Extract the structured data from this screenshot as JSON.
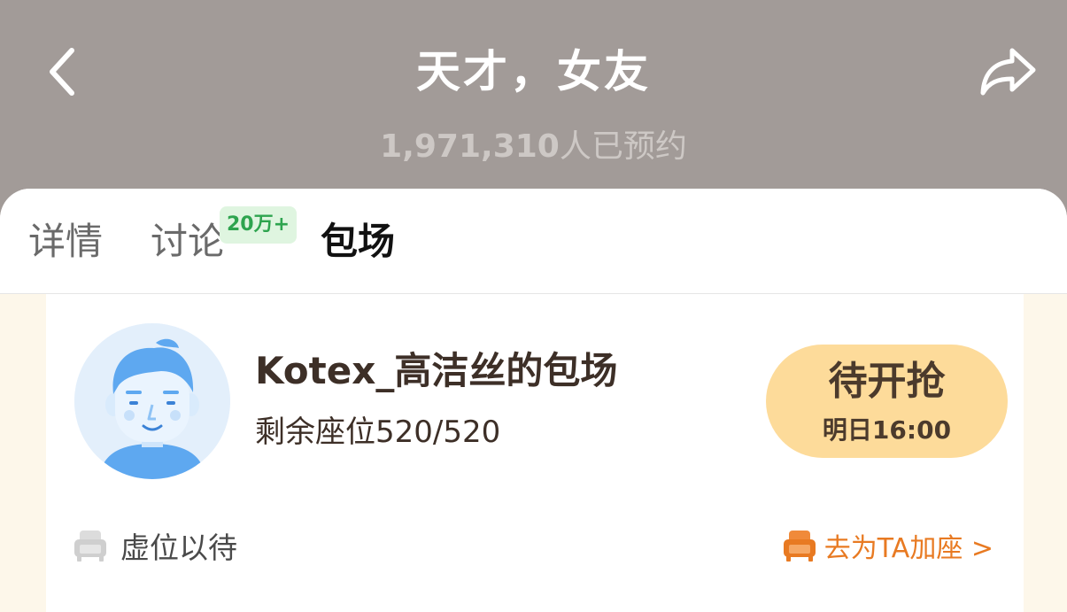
{
  "header": {
    "title": "天才，女友",
    "reservation_count": "1,971,310",
    "reservation_suffix": "人已预约"
  },
  "tabs": [
    {
      "label": "详情",
      "active": false
    },
    {
      "label": "讨论",
      "active": false,
      "badge": "20万+"
    },
    {
      "label": "包场",
      "active": true
    }
  ],
  "room": {
    "name": "Kotex_高洁丝的包场",
    "seats_remaining": "剩余座位520/520",
    "grab_button_label": "待开抢",
    "grab_time": "明日16:00",
    "waiting_label": "虚位以待",
    "add_seat_label": "去为TA加座 >"
  },
  "icons": {
    "back": "chevron-left-icon",
    "share": "share-arrow-icon",
    "avatar": "default-avatar-icon",
    "waiting_seat": "sofa-icon",
    "add_seat": "sofa-icon"
  },
  "colors": {
    "header_bg": "#a29b98",
    "accent_orange": "#e87a22",
    "button_yellow": "#fddb9a",
    "badge_green": "#2ea44f",
    "content_cream": "#fdf7ea"
  }
}
